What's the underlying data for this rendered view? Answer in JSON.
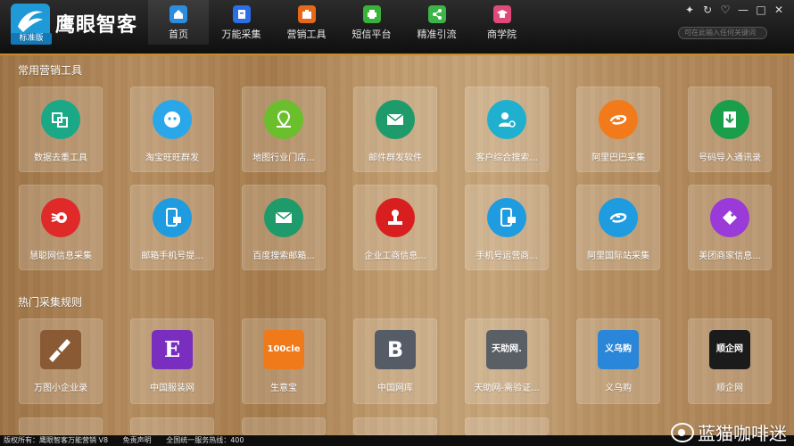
{
  "app": {
    "title": "鹰眼智客",
    "edition_tag": "标准版"
  },
  "nav": [
    {
      "label": "首页",
      "icon": "home-icon",
      "color": "#2a8de0"
    },
    {
      "label": "万能采集",
      "icon": "collect-icon",
      "color": "#2a6ee8"
    },
    {
      "label": "营销工具",
      "icon": "briefcase-icon",
      "color": "#e8681a"
    },
    {
      "label": "短信平台",
      "icon": "printer-icon",
      "color": "#39b23a"
    },
    {
      "label": "精准引流",
      "icon": "share-icon",
      "color": "#3cb448"
    },
    {
      "label": "商学院",
      "icon": "graduation-icon",
      "color": "#e04a7a"
    }
  ],
  "window_controls": [
    "✦",
    "↻",
    "♡",
    "—",
    "□",
    "✕"
  ],
  "search": {
    "placeholder": "可在此输入任何关键词"
  },
  "sections": {
    "tools_title": "常用营销工具",
    "rules_title": "热门采集规则"
  },
  "tools_row1": [
    {
      "label": "数据去重工具",
      "icon": "dedupe-icon",
      "color": "#1aa886"
    },
    {
      "label": "淘宝旺旺群发",
      "icon": "wangwang-icon",
      "color": "#2aa7e8"
    },
    {
      "label": "地图行业门店...",
      "icon": "map-pin-icon",
      "color": "#6cbf2c"
    },
    {
      "label": "邮件群发软件",
      "icon": "mail-icon",
      "color": "#1e9a6b"
    },
    {
      "label": "客户综合搜索...",
      "icon": "customer-search-icon",
      "color": "#1fb0cf"
    },
    {
      "label": "阿里巴巴采集",
      "icon": "alibaba-icon",
      "color": "#f27a1a"
    },
    {
      "label": "号码导入通讯录",
      "icon": "contacts-import-icon",
      "color": "#1a9e4a"
    }
  ],
  "tools_row2": [
    {
      "label": "慧聪网信息采集",
      "icon": "huicong-icon",
      "color": "#e02a2a"
    },
    {
      "label": "邮箱手机号提...",
      "icon": "phone-extract-icon",
      "color": "#1f9be0"
    },
    {
      "label": "百度搜索邮箱...",
      "icon": "mail-search-icon",
      "color": "#1e9a6b"
    },
    {
      "label": "企业工商信息...",
      "icon": "seal-icon",
      "color": "#d81e1e"
    },
    {
      "label": "手机号运营商...",
      "icon": "carrier-icon",
      "color": "#1f9be0"
    },
    {
      "label": "阿里国际站采集",
      "icon": "alibaba-intl-icon",
      "color": "#1f9be0"
    },
    {
      "label": "美团商家信息...",
      "icon": "meituan-icon",
      "color": "#9a3ad8"
    }
  ],
  "rules_row": [
    {
      "label": "万图小企业录",
      "logo": "",
      "color": "#8a5a34",
      "icon": "wantu-logo-icon"
    },
    {
      "label": "中国服装网",
      "logo": "E",
      "color": "#7a2ec0",
      "icon": "fashion-logo-icon"
    },
    {
      "label": "生意宝",
      "logo": "100cle",
      "color": "#f07a1a",
      "icon": "shengyibao-logo-icon"
    },
    {
      "label": "中国网库",
      "logo": "B",
      "color": "#555c66",
      "icon": "wangku-logo-icon"
    },
    {
      "label": "天助网-需验证...",
      "logo": "天助网.",
      "color": "#5a5f66",
      "icon": "tianzhu-logo-icon"
    },
    {
      "label": "义乌购",
      "logo": "义乌购",
      "color": "#2a86d8",
      "icon": "yiwugou-logo-icon"
    },
    {
      "label": "顺企网",
      "logo": "顺企网",
      "color": "#1b1b1b",
      "icon": "shunqi-logo-icon"
    }
  ],
  "status": {
    "copyright": "版权所有：鹰眼智客万能营销 V8",
    "disclaimer": "免责声明",
    "hotline": "全国统一服务热线：400"
  },
  "watermark": "蓝猫咖啡迷"
}
